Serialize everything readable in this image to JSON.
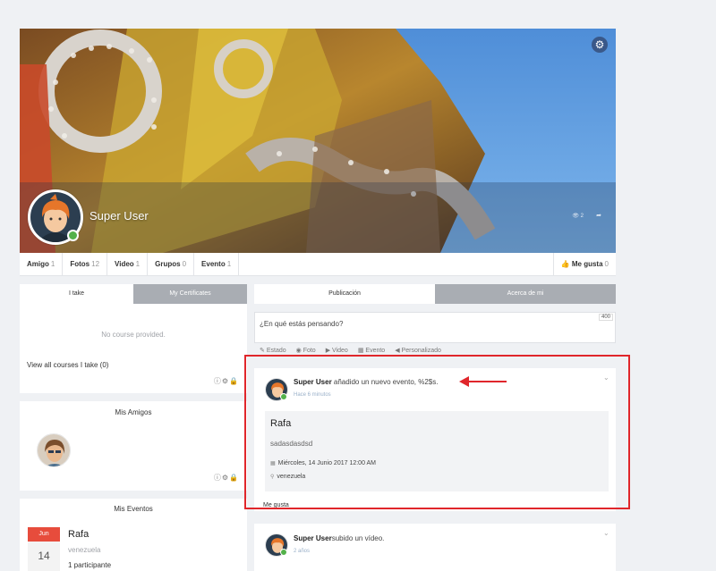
{
  "cover": {
    "user_name": "Super User",
    "stats_text": "👁 2",
    "share_icon": "share-icon",
    "settings_icon": "gear-icon"
  },
  "profile_tabs": [
    {
      "label": "Amigo",
      "count": "1"
    },
    {
      "label": "Fotos",
      "count": "12"
    },
    {
      "label": "Video",
      "count": "1"
    },
    {
      "label": "Grupos",
      "count": "0"
    },
    {
      "label": "Evento",
      "count": "1"
    }
  ],
  "like_tab": {
    "label": "Me gusta",
    "count": "0"
  },
  "courses_panel": {
    "tab_active": "I take",
    "tab_inactive": "My Certificates",
    "empty_text": "No course provided.",
    "view_all": "View all courses I take (0)"
  },
  "friends_panel": {
    "title": "Mis Amigos"
  },
  "events_panel": {
    "title": "Mis Eventos",
    "month": "Jun",
    "day": "14",
    "event_name": "Rafa",
    "location": "venezuela",
    "participants": "1 participante"
  },
  "stream_tabs": {
    "active": "Publicación",
    "inactive": "Acerca de mi"
  },
  "composer": {
    "placeholder": "¿En qué estás pensando?",
    "char_count": "400",
    "actions": [
      "Estado",
      "Foto",
      "Video",
      "Evento",
      "Personalizado"
    ]
  },
  "post1": {
    "author": "Super User",
    "action_text": " añadido un nuevo evento, %2$s.",
    "time": "Hace 6 minutos",
    "event_title": "Rafa",
    "event_desc": "sadasdasdsd",
    "event_date": "Miércoles, 14 Junio 2017 12:00 AM",
    "event_place": "venezuela",
    "like_link": "Me gusta"
  },
  "post2": {
    "author": "Super User",
    "action_text": "subido un vídeo.",
    "time": "2 años"
  },
  "colors": {
    "accent_red": "#e0262b",
    "online_green": "#53b14a",
    "event_month_bg": "#e74c3c"
  }
}
